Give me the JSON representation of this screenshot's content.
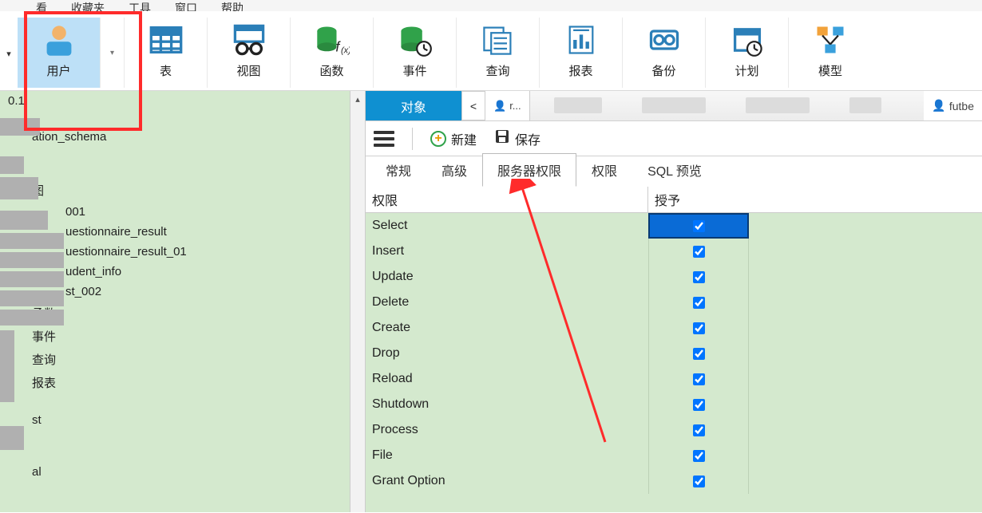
{
  "menu": {
    "items": [
      "看",
      "收藏夹",
      "工具",
      "窗口",
      "帮助"
    ]
  },
  "ribbon": {
    "buttons": [
      {
        "id": "user",
        "label": "用户"
      },
      {
        "id": "table",
        "label": "表"
      },
      {
        "id": "view",
        "label": "视图"
      },
      {
        "id": "func",
        "label": "函数"
      },
      {
        "id": "event",
        "label": "事件"
      },
      {
        "id": "query",
        "label": "查询"
      },
      {
        "id": "report",
        "label": "报表"
      },
      {
        "id": "backup",
        "label": "备份"
      },
      {
        "id": "plan",
        "label": "计划"
      },
      {
        "id": "model",
        "label": "模型"
      }
    ]
  },
  "sidebar": {
    "items": [
      {
        "indent": 0,
        "text": "0.1"
      },
      {
        "indent": 1,
        "text": "ation_schema"
      },
      {
        "indent": 1,
        "text": "图"
      },
      {
        "indent": 2,
        "text": "001"
      },
      {
        "indent": 2,
        "text": "uestionnaire_result"
      },
      {
        "indent": 2,
        "text": "uestionnaire_result_01"
      },
      {
        "indent": 2,
        "text": "udent_info"
      },
      {
        "indent": 2,
        "text": "st_002"
      },
      {
        "indent": 1,
        "text": "函数"
      },
      {
        "indent": 1,
        "text": "事件"
      },
      {
        "indent": 1,
        "text": "查询"
      },
      {
        "indent": 1,
        "text": "报表"
      },
      {
        "indent": 1,
        "text": "st"
      },
      {
        "indent": 1,
        "text": "al"
      }
    ]
  },
  "main": {
    "object_tab": "对象",
    "mini_tab": "r...",
    "user_chip": "futbe",
    "toolbar": {
      "new_label": "新建",
      "save_label": "保存"
    },
    "inner_tabs": [
      "常规",
      "高级",
      "服务器权限",
      "权限",
      "SQL 预览"
    ],
    "active_inner_tab": 2,
    "perm_header": {
      "privilege": "权限",
      "grant": "授予"
    },
    "perms": [
      {
        "name": "Select",
        "granted": true,
        "selected": true
      },
      {
        "name": "Insert",
        "granted": true
      },
      {
        "name": "Update",
        "granted": true
      },
      {
        "name": "Delete",
        "granted": true
      },
      {
        "name": "Create",
        "granted": true
      },
      {
        "name": "Drop",
        "granted": true
      },
      {
        "name": "Reload",
        "granted": true
      },
      {
        "name": "Shutdown",
        "granted": true
      },
      {
        "name": "Process",
        "granted": true
      },
      {
        "name": "File",
        "granted": true
      },
      {
        "name": "Grant Option",
        "granted": true
      }
    ]
  },
  "icons": {
    "user": "user-icon",
    "table": "table-icon",
    "view": "view-icon",
    "func": "function-icon",
    "event": "event-icon",
    "query": "query-icon",
    "report": "report-icon",
    "backup": "backup-icon",
    "plan": "plan-icon",
    "model": "model-icon"
  },
  "colors": {
    "accent_blue": "#0f90d1",
    "highlight_red": "#ff2b2b",
    "panel_green": "#d4e9ce",
    "select_blue": "#0a6bd6"
  }
}
